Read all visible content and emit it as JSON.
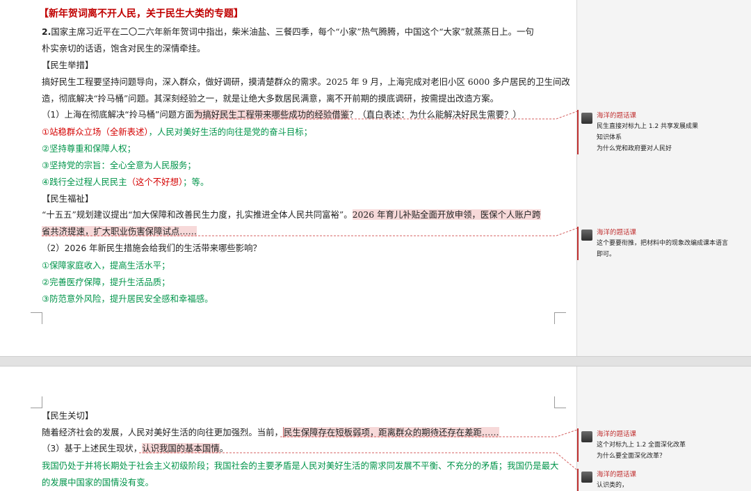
{
  "page1": {
    "title": "【新年贺词离不开人民，关于民生大类的专题】",
    "intro_num": "2.",
    "intro_line1": "国家主席习近平在二〇二六年新年贺词中指出，柴米油盐、三餐四季，每个“小家”热气腾腾，中国这个“大家”就蒸蒸日上。一句",
    "intro_line2": "朴实亲切的话语，饱含对民生的深情牵挂。",
    "sec1": "【民生举措】",
    "p1_line1": "搞好民生工程要坚持问题导向，深入群众，做好调研，摸清楚群众的需求。2025 年 9 月，上海完成对老旧小区 6000 多户居民的卫生间改",
    "p1_line2": "造，彻底解决“拎马桶”问题。其深刻经验之一，就是让绝大多数居民满意，离不开前期的摸底调研，按需提出改造方案。",
    "q1_a": "（1）上海在彻底解决“拎马桶”问题方面",
    "q1_hl": "为搞好民生工程带来哪些成功的经验借鉴",
    "q1_b": "？（直白表述：为什么能解决好民生需要？）",
    "a1_red": "①站稳群众立场（全新表述）",
    "a1_green": "，人民对美好生活的向往是党的奋斗目标；",
    "a2": "②坚持尊重和保障人权；",
    "a3": "③坚持党的宗旨：全心全意为人民服务；",
    "a4_green1": "④践行全过程人民民主",
    "a4_red": "（这个不好想）",
    "a4_green2": "；等。",
    "sec2": "【民生福祉】",
    "p2_a": "“十五五”规划建议提出“加大保障和改善民生力度，扎实推进全体人民共同富裕”。",
    "p2_hl": "2026 年育儿补贴全面开放申领，医保个人账户跨",
    "p2_line2": "省共济提速，扩大职业伤害保障试点……",
    "q2": "（2）2026 年新民生措施会给我们的生活带来哪些影响？",
    "b1": "①保障家庭收入，提高生活水平；",
    "b2": "②完善医疗保障，提升生活品质；",
    "b3": "③防范意外风险，提升居民安全感和幸福感。"
  },
  "page2": {
    "sec3": "【民生关切】",
    "p3_a": "随着经济社会的发展，人民对美好生活的向往更加强烈。当前，",
    "p3_hl": "民生保障存在短板弱项，距离群众的期待还存在差距……",
    "q3_a": "（3）基于上述民生现状，",
    "q3_hl": "认识我国的基本国情",
    "q3_b": "。",
    "c1": "我国仍处于并将长期处于社会主义初级阶段；我国社会的主要矛盾是人民对美好生活的需求同发展不平衡、不充分的矛盾；我国仍是最大",
    "c2": "的发展中国家的国情没有变。"
  },
  "comments": [
    {
      "author": "海洋的题话课",
      "text": "民生直接对标九上 1.2 共享发展成果\n知识体系\n为什么党和政府要对人民好"
    },
    {
      "author": "海洋的题话课",
      "text": "这个要要衔推，把材料中的现象改编成课本语言\n即可。"
    },
    {
      "author": "海洋的题话课",
      "text": "这个对标九上 1.2 全面深化改革\n为什么要全面深化改革？"
    },
    {
      "author": "海洋的题话课",
      "text": "认识类的，"
    }
  ],
  "colors": {
    "title_red": "#c00000",
    "answer_red": "#d40000",
    "answer_green": "#00944a",
    "highlight": "#f7d9d9"
  }
}
